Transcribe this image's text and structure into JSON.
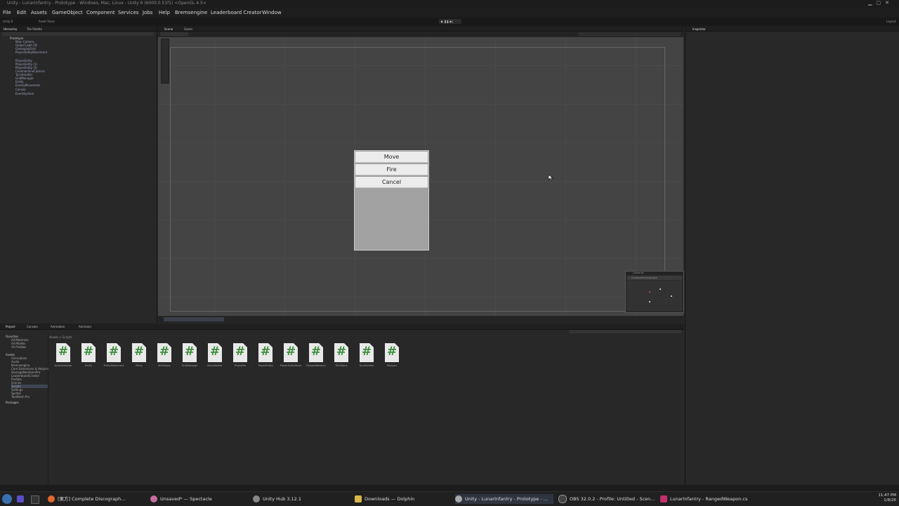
{
  "window": {
    "title": "Unity - LunarInfantry - Prototype - Windows, Mac, Linux - Unity 6 (6000.0.51f1) <OpenGL 4.5>"
  },
  "menu": [
    "File",
    "Edit",
    "Assets",
    "GameObject",
    "Component",
    "Services",
    "Jobs",
    "Help",
    "Bremsengine",
    "Leaderboard Creator",
    "Window"
  ],
  "toolbar": {
    "account": "Unity 6",
    "asset_store": "Asset Store",
    "layout": "Layout"
  },
  "hierarchy": {
    "tabs": [
      "Hierarchy",
      "Tile Palette"
    ],
    "scene": "Prototype",
    "items": [
      "Main Camera",
      "Global Light 2D",
      "GameplayGrid",
      "PlayerEntityMovement",
      "",
      "PlayerEntity",
      "PlayerEntity (1)",
      "PlayerEntity (2)",
      "CinemachineCamera",
      "TurnHandler",
      "GridManager",
      "Entity",
      "EnemyMovement",
      "Canvas",
      "EventSystem"
    ]
  },
  "scene": {
    "tabs": [
      "Scene",
      "Game"
    ]
  },
  "game_menu": {
    "buttons": [
      "Move",
      "Fire",
      "Cancel"
    ]
  },
  "camera_preview": {
    "title": "Cameras",
    "camera": "CinemachineCamera"
  },
  "inspector": {
    "tab": "Inspector"
  },
  "project": {
    "tabs": [
      "Project",
      "Console",
      "Animation",
      "Animator"
    ],
    "breadcrumb": "Assets > Scripts",
    "favorites_label": "Favorites",
    "favorites": [
      "All Materials",
      "All Models",
      "All Prefabs"
    ],
    "assets_label": "Assets",
    "folders": [
      "Animations",
      "Audio",
      "Bremsengine",
      "Core Extensions & Helpers",
      "DamageNumbersPro",
      "LeaderboardCreator",
      "Prefabs",
      "Scenes",
      "Scripts",
      "Settings",
      "Sprites",
      "TextMesh Pro"
    ],
    "packages_label": "Packages",
    "files": [
      "ActionSelector",
      "Entity",
      "EntityMovement",
      "IMoly",
      "IdleHelper",
      "GridManager",
      "MoveMarker",
      "Projectile",
      "PlayerEntity",
      "PlayerEntityMove",
      "RangedWeapon",
      "TileObject",
      "TurnHandler",
      "Weapon"
    ]
  },
  "taskbar": {
    "items": [
      "[東方] Complete Discograph...",
      "Unsaved* — Spectacle",
      "Unity Hub 3.12.1",
      "Downloads — Dolphin",
      "Unity - LunarInfantry - Prototype - ...",
      "OBS 32.0.2 - Profile: Untitled - Scen...",
      "LunarInfantry - RangedWeapon.cs"
    ],
    "time": "11:47 PM",
    "date": "1/8/26"
  },
  "colors": {
    "editor_bg": "#282828",
    "scene_bg": "#444444",
    "script_icon_green": "#3e8f3e",
    "button_bg": "#ececec",
    "menu_panel": "#a2a2a2"
  }
}
